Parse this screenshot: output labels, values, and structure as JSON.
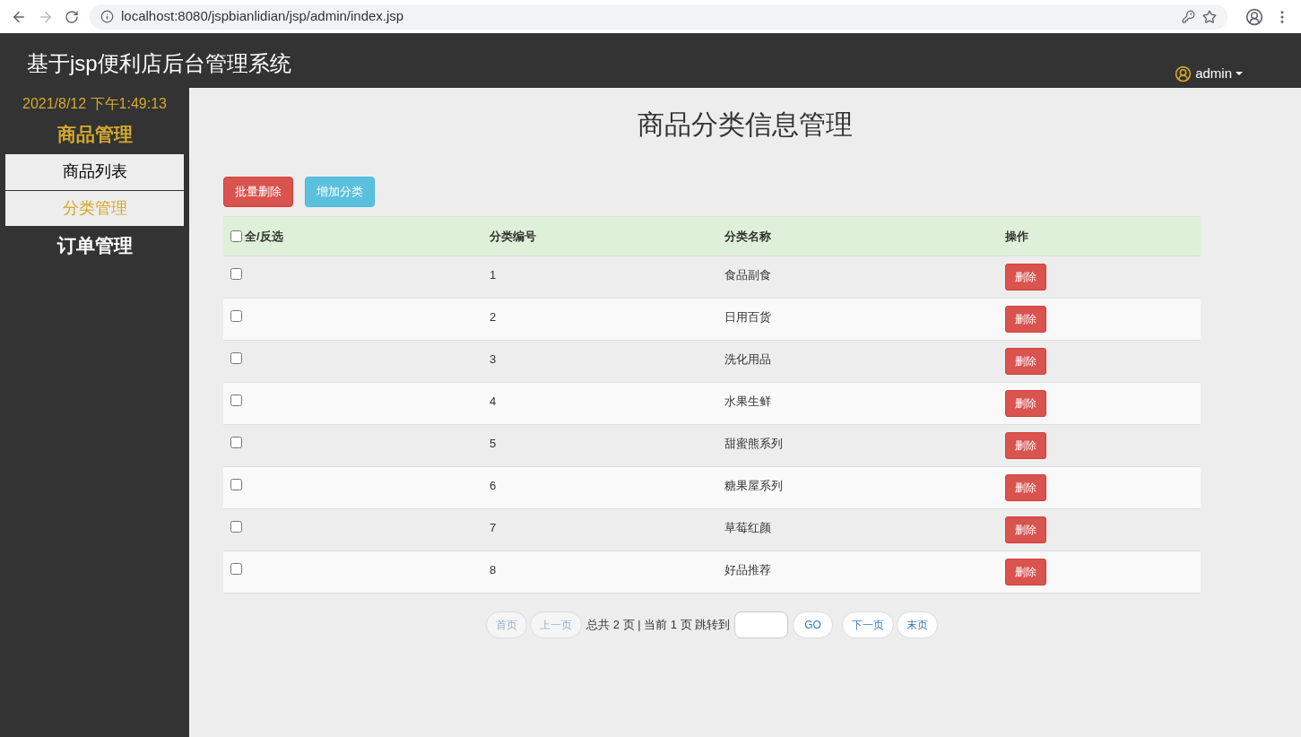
{
  "browser": {
    "url": "localhost:8080/jspbianlidian/jsp/admin/index.jsp"
  },
  "header": {
    "title": "基于jsp便利店后台管理系统",
    "user": "admin"
  },
  "sidebar": {
    "datetime": "2021/8/12 下午1:49:13",
    "groups": [
      {
        "title": "商品管理",
        "expanded": true,
        "items": [
          {
            "label": "商品列表",
            "selected": false
          },
          {
            "label": "分类管理",
            "selected": true
          }
        ]
      },
      {
        "title": "订单管理",
        "expanded": false
      }
    ]
  },
  "page_title": "商品分类信息管理",
  "toolbar": [
    {
      "label": "批量删除",
      "kind": "danger"
    },
    {
      "label": "增加分类",
      "kind": "info"
    }
  ],
  "table": {
    "select_all": {
      "label": "全/反选",
      "checked": false
    },
    "columns": [
      "分类编号",
      "分类名称",
      "操作"
    ],
    "rows": [
      {
        "checked": false,
        "id": "1",
        "name": "食品副食",
        "action": "删除"
      },
      {
        "checked": false,
        "id": "2",
        "name": "日用百货",
        "action": "删除"
      },
      {
        "checked": false,
        "id": "3",
        "name": "洗化用品",
        "action": "删除"
      },
      {
        "checked": false,
        "id": "4",
        "name": "水果生鲜",
        "action": "删除"
      },
      {
        "checked": false,
        "id": "5",
        "name": "甜蜜熊系列",
        "action": "删除"
      },
      {
        "checked": false,
        "id": "6",
        "name": "糖果屋系列",
        "action": "删除"
      },
      {
        "checked": false,
        "id": "7",
        "name": "草莓红颜",
        "action": "删除"
      },
      {
        "checked": false,
        "id": "8",
        "name": "好品推荐",
        "action": "删除"
      }
    ]
  },
  "pagination": {
    "first": {
      "label": "首页",
      "disabled": true
    },
    "prev": {
      "label": "上一页",
      "disabled": true
    },
    "info": "总共 2 页 | 当前 1 页 跳转到",
    "go": "GO",
    "next": {
      "label": "下一页",
      "disabled": false
    },
    "last": {
      "label": "末页",
      "disabled": false
    }
  }
}
